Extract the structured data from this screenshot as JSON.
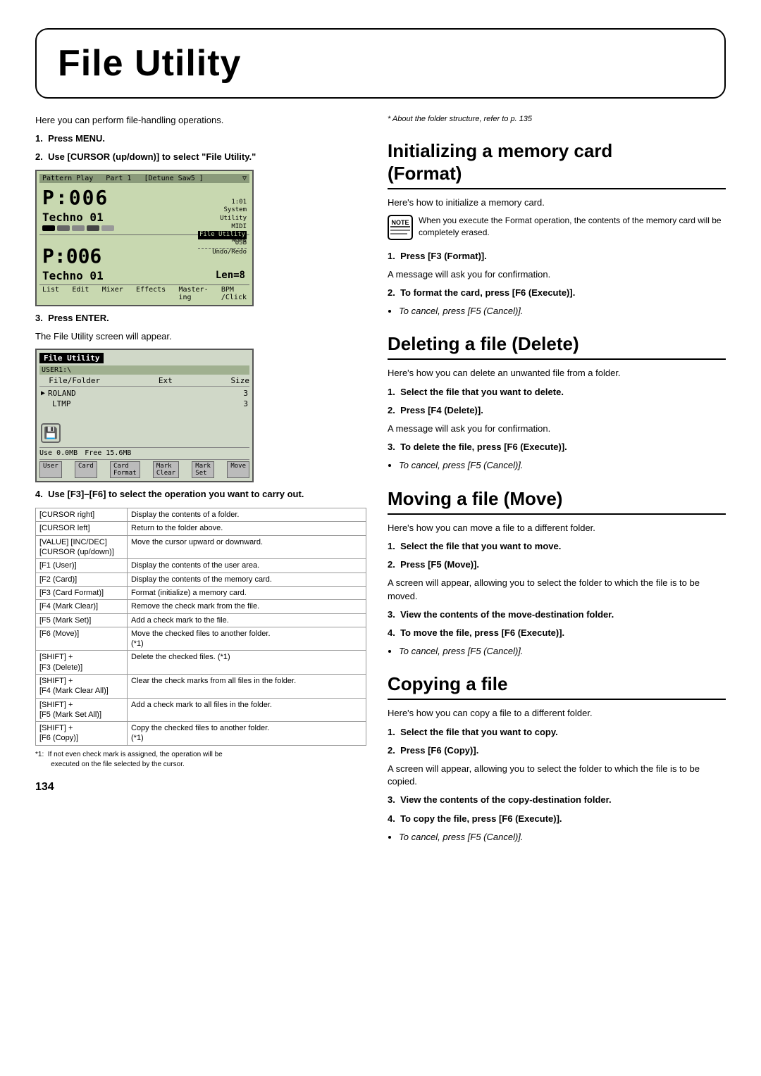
{
  "page": {
    "title": "File Utility",
    "page_number": "134",
    "intro": "Here you can perform file-handling operations.",
    "steps_intro": [
      {
        "num": "1.",
        "text": "Press MENU."
      },
      {
        "num": "2.",
        "text": "Use [CURSOR (up/down)] to select \"File Utility.\""
      }
    ],
    "step3": {
      "num": "3.",
      "text": "Press ENTER."
    },
    "step3_sub": "The File Utility screen will appear.",
    "step4": {
      "num": "4.",
      "text": "Use [F3]–[F6] to select the operation you want to carry out."
    },
    "key_table": [
      {
        "key": "[CURSOR right]",
        "desc": "Display the contents of a folder."
      },
      {
        "key": "[CURSOR left]",
        "desc": "Return to the folder above."
      },
      {
        "key": "[VALUE] [INC/DEC]\n[CURSOR (up/down)]",
        "desc": "Move the cursor upward or downward."
      },
      {
        "key": "[F1 (User)]",
        "desc": "Display the contents of the user area."
      },
      {
        "key": "[F2 (Card)]",
        "desc": "Display the contents of the memory card."
      },
      {
        "key": "[F3 (Card Format)]",
        "desc": "Format (initialize) a memory card."
      },
      {
        "key": "[F4 (Mark Clear)]",
        "desc": "Remove the check mark from the file."
      },
      {
        "key": "[F5 (Mark Set)]",
        "desc": "Add a check mark to the file."
      },
      {
        "key": "[F6 (Move)]",
        "desc": "Move the checked files to another folder.\n(*1)"
      },
      {
        "key": "[SHIFT] +\n[F3 (Delete)]",
        "desc": "Delete the checked files. (*1)"
      },
      {
        "key": "[SHIFT] +\n[F4 (Mark Clear All)]",
        "desc": "Clear the check marks from all files in the folder."
      },
      {
        "key": "[SHIFT] +\n[F5 (Mark Set All)]",
        "desc": "Add a check mark to all files in the folder."
      },
      {
        "key": "[SHIFT] +\n[F6 (Copy)]",
        "desc": "Copy the checked files to another folder.\n(*1)"
      }
    ],
    "footnote": "*1:   If not even check mark is assigned, the operation will be\n        executed on the file selected by the cursor.",
    "folder_note": "* About the folder structure, refer to p. 135",
    "sections": {
      "init": {
        "title": "Initializing a memory card (Format)",
        "intro": "Here's how to initialize a memory card.",
        "note": "When you execute the Format operation, the contents of the memory card will be completely erased.",
        "steps": [
          {
            "num": "1.",
            "text": "Press [F3 (Format)].",
            "bold": true
          },
          {
            "num": "",
            "text": "A message will ask you for confirmation."
          },
          {
            "num": "2.",
            "text": "To format the card, press [F6 (Execute)].",
            "bold": true
          },
          {
            "num": "*",
            "text": "To cancel, press [F5 (Cancel)]."
          }
        ]
      },
      "delete": {
        "title": "Deleting a file (Delete)",
        "intro": "Here's how you can delete an unwanted file from a folder.",
        "steps": [
          {
            "num": "1.",
            "text": "Select the file that you want to delete.",
            "bold": true
          },
          {
            "num": "2.",
            "text": "Press [F4 (Delete)].",
            "bold": true
          },
          {
            "num": "",
            "text": "A message will ask you for confirmation."
          },
          {
            "num": "3.",
            "text": "To delete the file, press [F6 (Execute)].",
            "bold": true
          },
          {
            "num": "*",
            "text": "To cancel, press [F5 (Cancel)]."
          }
        ]
      },
      "move": {
        "title": "Moving a file (Move)",
        "intro": "Here's how you can move a file to a different folder.",
        "steps": [
          {
            "num": "1.",
            "text": "Select the file that you want to move.",
            "bold": true
          },
          {
            "num": "2.",
            "text": "Press [F5 (Move)].",
            "bold": true
          },
          {
            "num": "",
            "text": "A screen will appear, allowing you to select the folder to which the file is to be moved."
          },
          {
            "num": "3.",
            "text": "View the contents of the move-destination folder.",
            "bold": true
          },
          {
            "num": "4.",
            "text": "To move the file, press [F6 (Execute)].",
            "bold": true
          },
          {
            "num": "*",
            "text": "To cancel, press [F5 (Cancel)]."
          }
        ]
      },
      "copy": {
        "title": "Copying a file",
        "intro": "Here's how you can copy a file to a different folder.",
        "steps": [
          {
            "num": "1.",
            "text": "Select the file that you want to copy.",
            "bold": true
          },
          {
            "num": "2.",
            "text": "Press [F6 (Copy)].",
            "bold": true
          },
          {
            "num": "",
            "text": "A screen will appear, allowing you to select the folder to which the file is to be copied."
          },
          {
            "num": "3.",
            "text": "View the contents of the copy-destination folder.",
            "bold": true
          },
          {
            "num": "4.",
            "text": "To copy the file, press [F6 (Execute)].",
            "bold": true
          },
          {
            "num": "*",
            "text": "To cancel, press [F5 (Cancel)]."
          }
        ]
      }
    }
  }
}
